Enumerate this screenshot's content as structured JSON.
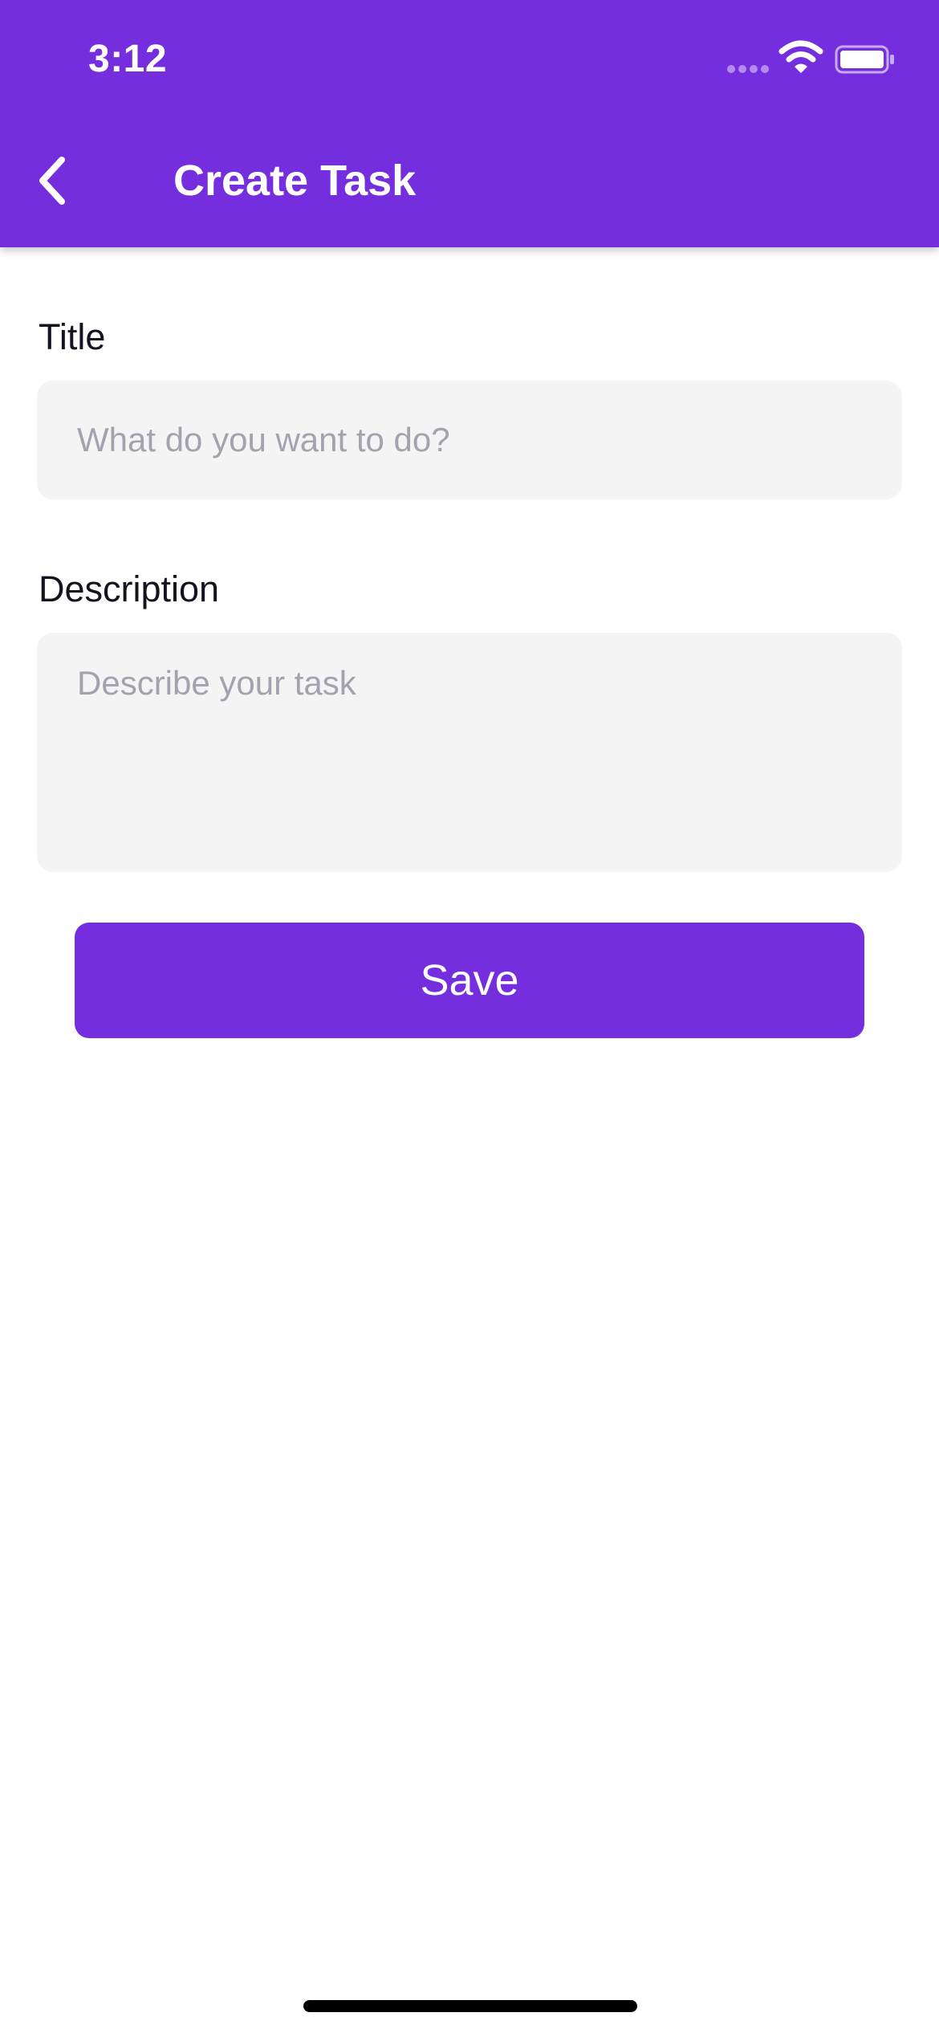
{
  "status_bar": {
    "time": "3:12"
  },
  "header": {
    "title": "Create Task",
    "back_icon": "chevron-left-icon"
  },
  "form": {
    "title_label": "Title",
    "title_value": "",
    "title_placeholder": "What do you want to do?",
    "description_label": "Description",
    "description_value": "",
    "description_placeholder": "Describe your task",
    "save_label": "Save"
  },
  "colors": {
    "accent": "#742EDD",
    "field_background": "#F4F4F4",
    "placeholder": "#A3A3AE",
    "label_text": "#141420"
  }
}
